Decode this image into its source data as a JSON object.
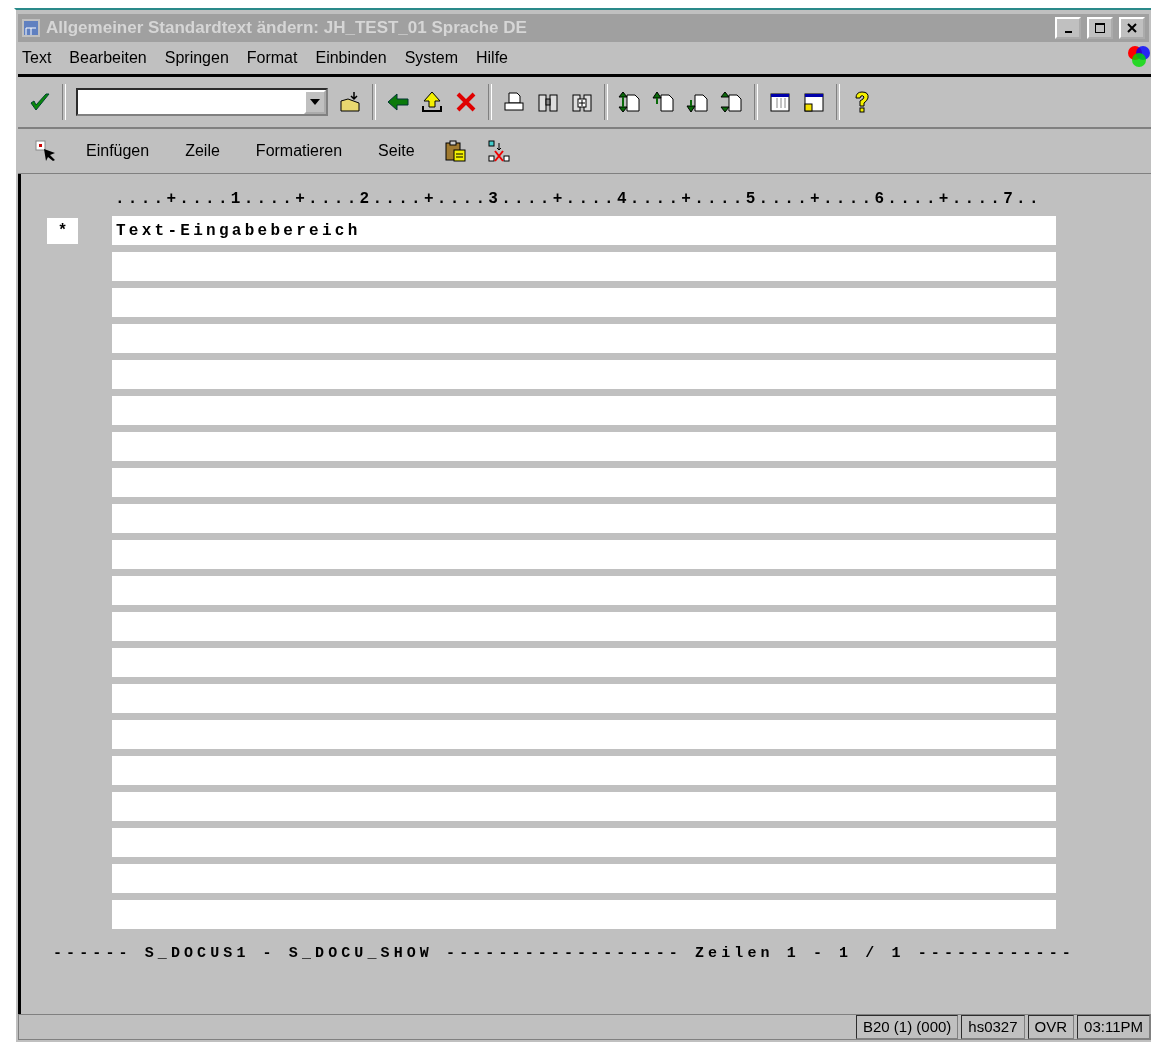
{
  "window": {
    "title": "Allgemeiner Standardtext ändern: JH_TEST_01 Sprache DE",
    "active": false
  },
  "menu": [
    "Text",
    "Bearbeiten",
    "Springen",
    "Format",
    "Einbinden",
    "System",
    "Hilfe"
  ],
  "app_toolbar": [
    {
      "kind": "select"
    },
    {
      "kind": "text",
      "label": "Einfügen"
    },
    {
      "kind": "text",
      "label": "Zeile"
    },
    {
      "kind": "text",
      "label": "Formatieren"
    },
    {
      "kind": "text",
      "label": "Seite"
    },
    {
      "kind": "paste"
    },
    {
      "kind": "unlink"
    }
  ],
  "editor": {
    "ruler": "....+....1....+....2....+....3....+....4....+....5....+....6....+....7..",
    "lines": [
      {
        "marker": "*",
        "text": "Text-Eingabebereich"
      }
    ],
    "footer": "------ S_DOCUS1 - S_DOCU_SHOW ------------------ Zeilen 1 - 1 / 1 ------------"
  },
  "status_bar": [
    "B20 (1) (000)",
    "hs0327",
    "OVR",
    "03:11PM"
  ]
}
